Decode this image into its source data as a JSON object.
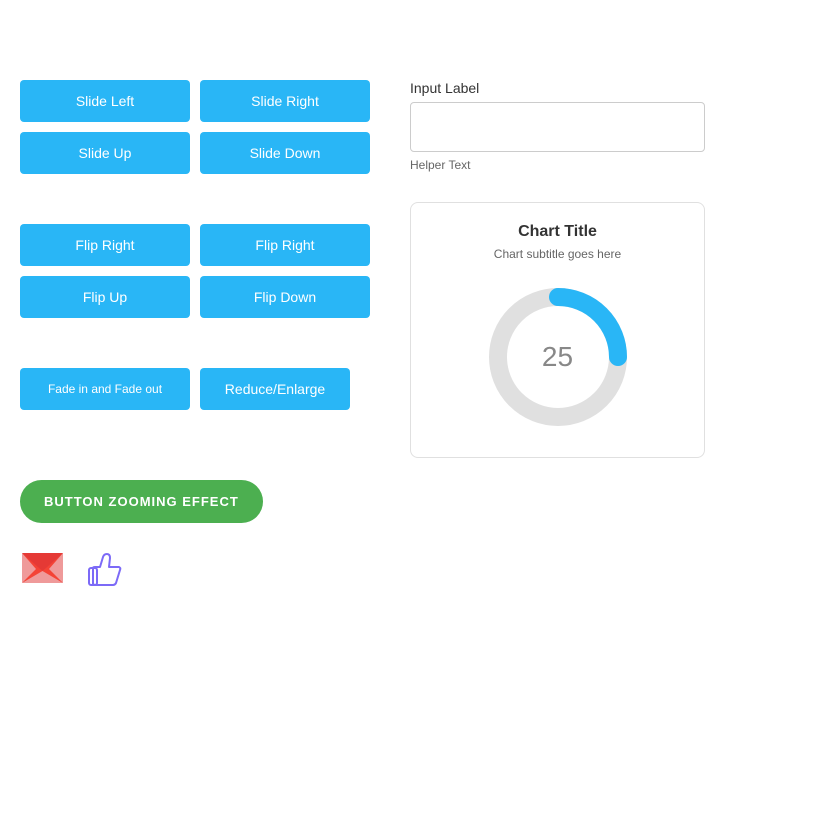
{
  "buttons": {
    "slide_left": "Slide Left",
    "slide_right": "Slide Right",
    "slide_up": "Slide Up",
    "slide_down": "Slide Down",
    "flip_right_1": "Flip Right",
    "flip_right_2": "Flip Right",
    "flip_up": "Flip Up",
    "flip_down": "Flip Down",
    "fade_in_out": "Fade in and Fade out",
    "reduce_enlarge": "Reduce/Enlarge",
    "zooming": "BUTTON ZOOMING EFFECT"
  },
  "input": {
    "label": "Input Label",
    "placeholder": "",
    "helper_text": "Helper Text"
  },
  "chart": {
    "title": "Chart Title",
    "subtitle": "Chart subtitle goes here",
    "value": "25",
    "percentage": 25,
    "color_filled": "#29b6f6",
    "color_bg": "#e0e0e0"
  }
}
